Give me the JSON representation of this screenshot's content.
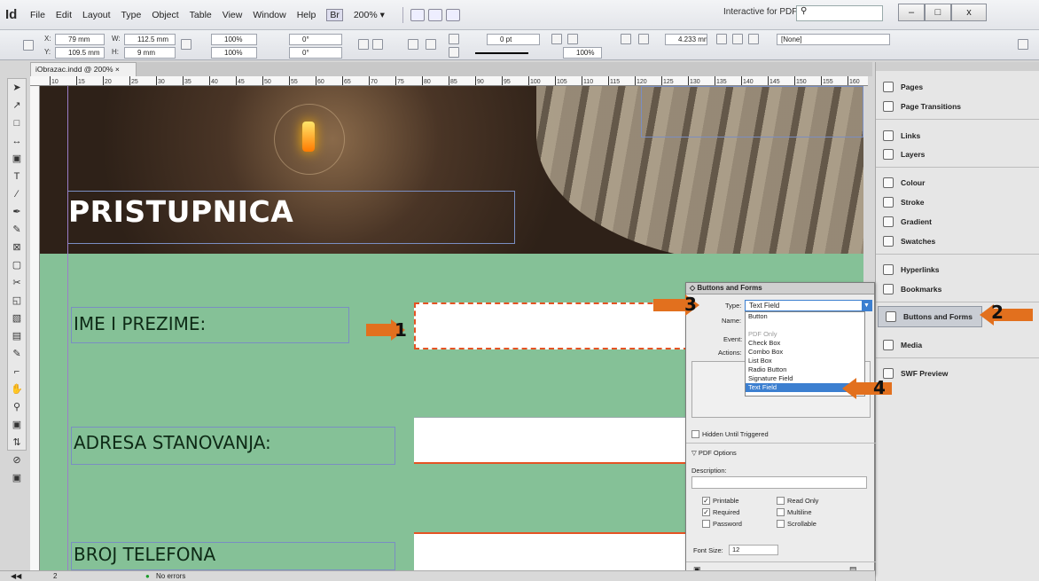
{
  "app": {
    "logo": "Id",
    "menus": [
      "File",
      "Edit",
      "Layout",
      "Type",
      "Object",
      "Table",
      "View",
      "Window",
      "Help"
    ],
    "br": "Br",
    "zoom": "200% ▾",
    "workspace": "Interactive for PDF ▾",
    "search_icon": "search-icon",
    "win_buttons": [
      "–",
      "□",
      "x"
    ]
  },
  "control": {
    "x": "79 mm",
    "y": "109.5 mm",
    "w": "112.5 mm",
    "h": "9 mm",
    "sx": "100%",
    "sy": "100%",
    "rot": "0°",
    "shear": "0°",
    "stroke": "0 pt",
    "opacity": "100%",
    "ref": "4.233 mm",
    "style": "[None]",
    "labels": {
      "x": "X:",
      "y": "Y:",
      "w": "W:",
      "h": "H:"
    }
  },
  "doc": {
    "tab": "iObrazac.indd @ 200%",
    "tab_close": "×",
    "ruler_marks": [
      "10",
      "15",
      "20",
      "25",
      "30",
      "35",
      "40",
      "45",
      "50",
      "55",
      "60",
      "65",
      "70",
      "75",
      "80",
      "85",
      "90",
      "95",
      "100",
      "105",
      "110",
      "115",
      "120",
      "125",
      "130",
      "135",
      "140",
      "145",
      "150",
      "155",
      "160"
    ]
  },
  "page": {
    "title": "PRISTUPNICA",
    "fields": [
      {
        "label": "IME I PREZIME:"
      },
      {
        "label": "ADRESA STANOVANJA:"
      },
      {
        "label": "BROJ TELEFONA"
      }
    ]
  },
  "arrows": [
    "1",
    "2",
    "3",
    "4"
  ],
  "panels": {
    "items": [
      {
        "label": "Pages"
      },
      {
        "label": "Page Transitions"
      },
      {
        "label": "Links"
      },
      {
        "label": "Layers"
      },
      {
        "label": "Colour"
      },
      {
        "label": "Stroke"
      },
      {
        "label": "Gradient"
      },
      {
        "label": "Swatches"
      },
      {
        "label": "Hyperlinks"
      },
      {
        "label": "Bookmarks"
      },
      {
        "label": "Buttons and Forms"
      },
      {
        "label": "Media"
      },
      {
        "label": "SWF Preview"
      }
    ]
  },
  "bf": {
    "title": "◇ Buttons and Forms",
    "type_label": "Type:",
    "type_value": "Text Field",
    "name_label": "Name:",
    "event_label": "Event:",
    "actions_label": "Actions:",
    "options": [
      "Button",
      "",
      "PDF Only",
      "Check Box",
      "Combo Box",
      "List Box",
      "Radio Button",
      "Signature Field",
      "Text Field"
    ],
    "hidden": "Hidden Until Triggered",
    "pdf_options": "▽ PDF Options",
    "description": "Description:",
    "checks": [
      {
        "label": "Printable",
        "checked": true
      },
      {
        "label": "Required",
        "checked": true
      },
      {
        "label": "Password",
        "checked": false
      },
      {
        "label": "Read Only",
        "checked": false
      },
      {
        "label": "Multiline",
        "checked": false
      },
      {
        "label": "Scrollable",
        "checked": false
      }
    ],
    "font_size_label": "Font Size:",
    "font_size": "12"
  },
  "status": {
    "page": "2",
    "errors": "No errors"
  },
  "colors": {
    "accent": "#e2701e",
    "canvas": "#85c197",
    "selection": "#3c7fd0"
  }
}
